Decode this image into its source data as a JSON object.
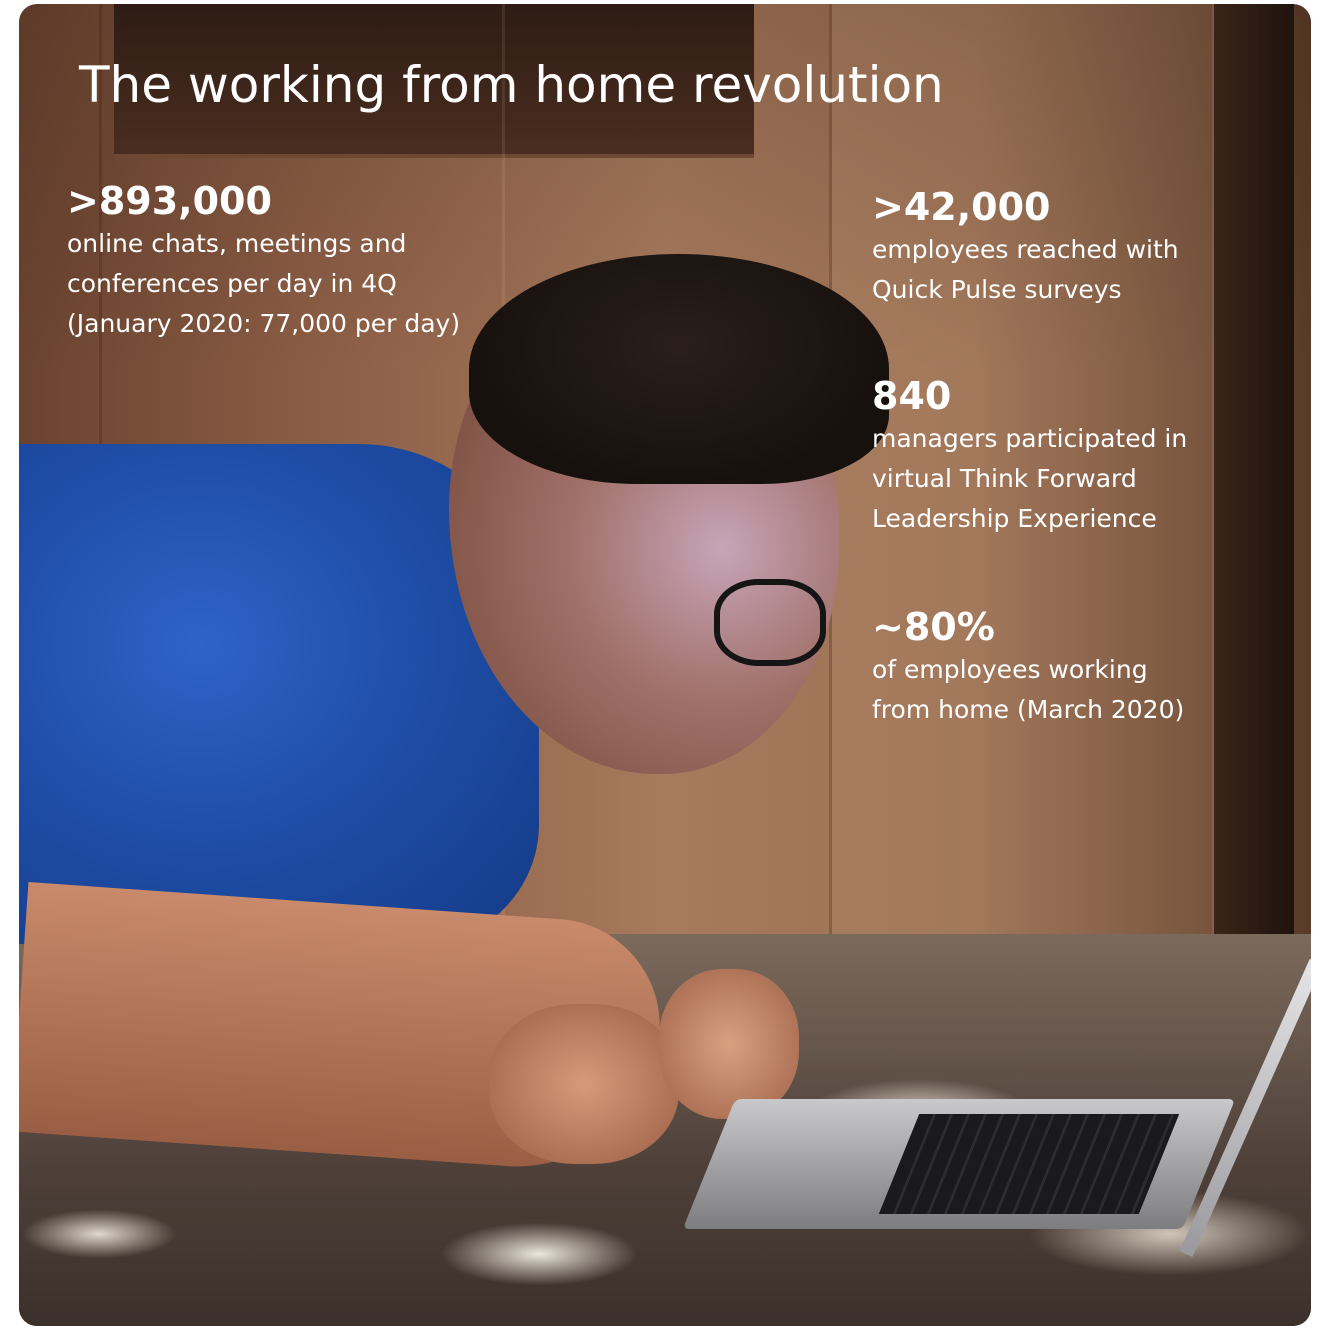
{
  "title": "The working from home revolution",
  "stats": [
    {
      "value": ">893,000",
      "lines": [
        "online chats, meetings and",
        "conferences per day in 4Q",
        "(January  2020: 77,000 per day)"
      ]
    },
    {
      "value": ">42,000",
      "lines": [
        "employees reached with",
        "Quick Pulse surveys"
      ]
    },
    {
      "value": "840",
      "lines": [
        "managers participated in",
        "virtual Think Forward",
        "Leadership Experience"
      ]
    },
    {
      "value": "~80%",
      "lines": [
        "of employees working",
        "from home (March 2020)"
      ]
    }
  ],
  "colors": {
    "text": "#ffffff",
    "shirt": "#1f4ea8",
    "wall": "#a77a5d"
  }
}
